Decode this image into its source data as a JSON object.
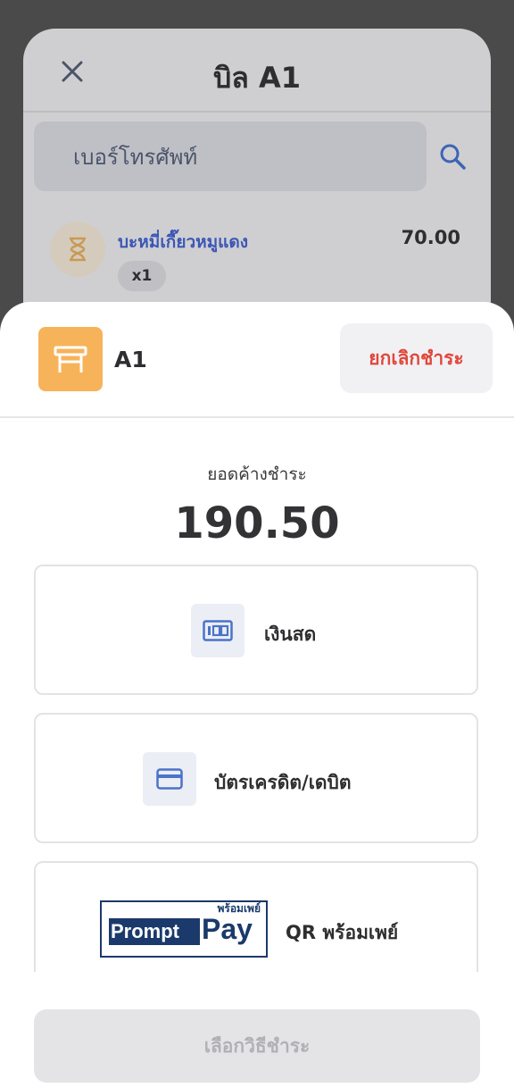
{
  "bill": {
    "title": "บิล A1",
    "phone_placeholder": "เบอร์โทรศัพท์",
    "item": {
      "name": "บะหมี่เกี๊ยวหมูแดง",
      "price": "70.00",
      "qty": "x1"
    }
  },
  "sheet": {
    "table_name": "A1",
    "cancel_label": "ยกเลิกชำระ",
    "outstanding_label": "ยอดค้างชำระ",
    "outstanding_amount": "190.50",
    "payment_options": {
      "cash": "เงินสด",
      "card": "บัตรเครดิต/เดบิต",
      "promptpay": "QR พร้อมเพย์"
    },
    "promptpay_logo": {
      "thai": "พร้อมเพย์",
      "prompt": "Prompt",
      "pay": "Pay"
    },
    "select_label": "เลือกวิธีชำระ"
  },
  "colors": {
    "accent_blue": "#4a74c9",
    "cancel_red": "#e0483c",
    "table_orange": "#f6b35a",
    "promptpay_navy": "#1b3a6b"
  },
  "icons": [
    "close-icon",
    "search-icon",
    "hourglass-icon",
    "table-icon",
    "cash-icon",
    "credit-card-icon"
  ]
}
